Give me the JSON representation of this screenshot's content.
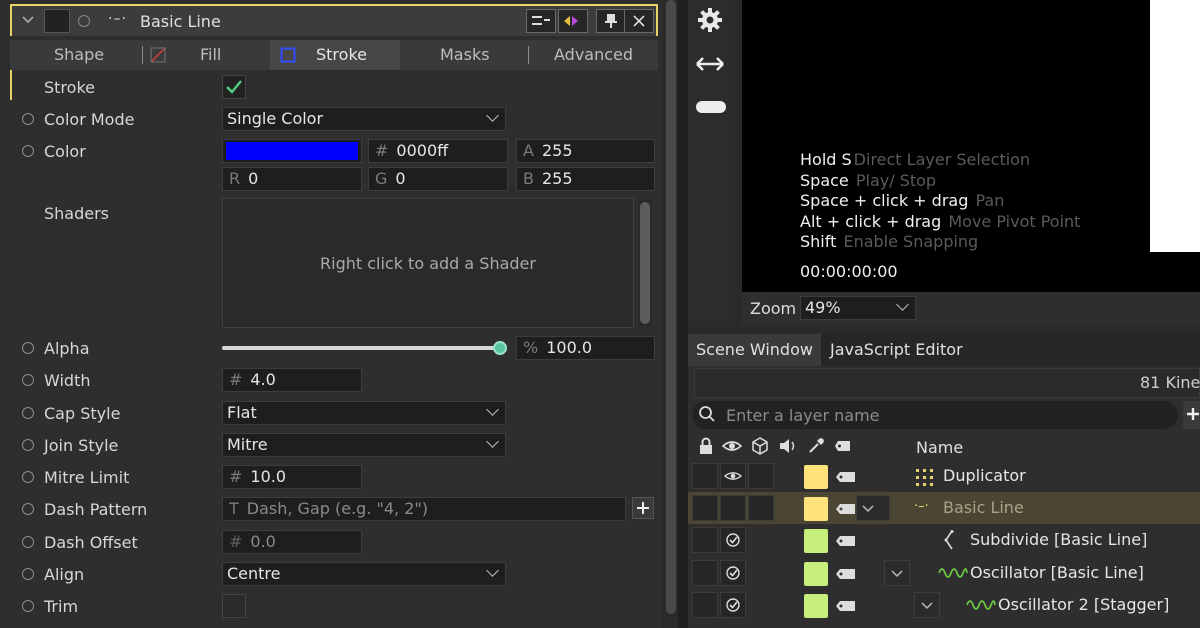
{
  "layer_header": {
    "title": "Basic Line",
    "type_icon": "basic-line-icon",
    "accent_color": "#e6d36a"
  },
  "tabs": [
    {
      "label": "Shape"
    },
    {
      "label": "Fill"
    },
    {
      "label": "Stroke",
      "active": true
    },
    {
      "label": "Masks"
    },
    {
      "label": "Advanced"
    }
  ],
  "properties": {
    "stroke": {
      "label": "Stroke",
      "checked": true
    },
    "color_mode": {
      "label": "Color Mode",
      "value": "Single Color"
    },
    "color": {
      "label": "Color",
      "swatch": "#0000ff",
      "hex_prefix": "#",
      "hex": "0000ff",
      "a_label": "A",
      "a": "255",
      "r_label": "R",
      "r": "0",
      "g_label": "G",
      "g": "0",
      "b_label": "B",
      "b": "255"
    },
    "shaders": {
      "label": "Shaders",
      "placeholder": "Right click to add a Shader"
    },
    "alpha": {
      "label": "Alpha",
      "level": 1.0,
      "prefix": "%",
      "value": "100.0"
    },
    "width": {
      "label": "Width",
      "prefix": "#",
      "value": "4.0"
    },
    "cap_style": {
      "label": "Cap Style",
      "value": "Flat"
    },
    "join_style": {
      "label": "Join Style",
      "value": "Mitre"
    },
    "mitre_limit": {
      "label": "Mitre Limit",
      "prefix": "#",
      "value": "10.0"
    },
    "dash_pattern": {
      "label": "Dash Pattern",
      "prefix": "T",
      "placeholder": "Dash, Gap (e.g. \"4, 2\")"
    },
    "dash_offset": {
      "label": "Dash Offset",
      "prefix": "#",
      "value": "0.0"
    },
    "align": {
      "label": "Align",
      "value": "Centre"
    },
    "trim": {
      "label": "Trim",
      "checked": false
    }
  },
  "viewport": {
    "hints": [
      {
        "key": "Hold S",
        "desc": "Direct Layer Selection"
      },
      {
        "key": "Space",
        "desc": "Play/ Stop"
      },
      {
        "key": "Space + click + drag",
        "desc": "Pan"
      },
      {
        "key": "Alt + click + drag",
        "desc": "Move Pivot Point"
      },
      {
        "key": "Shift",
        "desc": "Enable Snapping"
      }
    ],
    "timecode": "00:00:00:00",
    "zoom_label": "Zoom",
    "zoom_value": "49%"
  },
  "right_tabs": [
    {
      "label": "Scene Window",
      "active": true
    },
    {
      "label": "JavaScript Editor"
    }
  ],
  "layer_panel": {
    "info_text": "81 Kine",
    "search_placeholder": "Enter a layer name",
    "name_header": "Name",
    "layers": [
      {
        "name": "Duplicator",
        "icon": "duplicator-icon",
        "color": "#ffe27a"
      },
      {
        "name": "Basic Line",
        "icon": "basic-line-icon",
        "color": "#ffe27a",
        "selected": true
      },
      {
        "name": "Subdivide [Basic Line]",
        "icon": "subdivide-icon",
        "color": "#c6ee7a"
      },
      {
        "name": "Oscillator [Basic Line]",
        "icon": "oscillator-icon",
        "color": "#c6ee7a"
      },
      {
        "name": "Oscillator 2 [Stagger]",
        "icon": "oscillator-icon",
        "color": "#c6ee7a"
      }
    ]
  }
}
